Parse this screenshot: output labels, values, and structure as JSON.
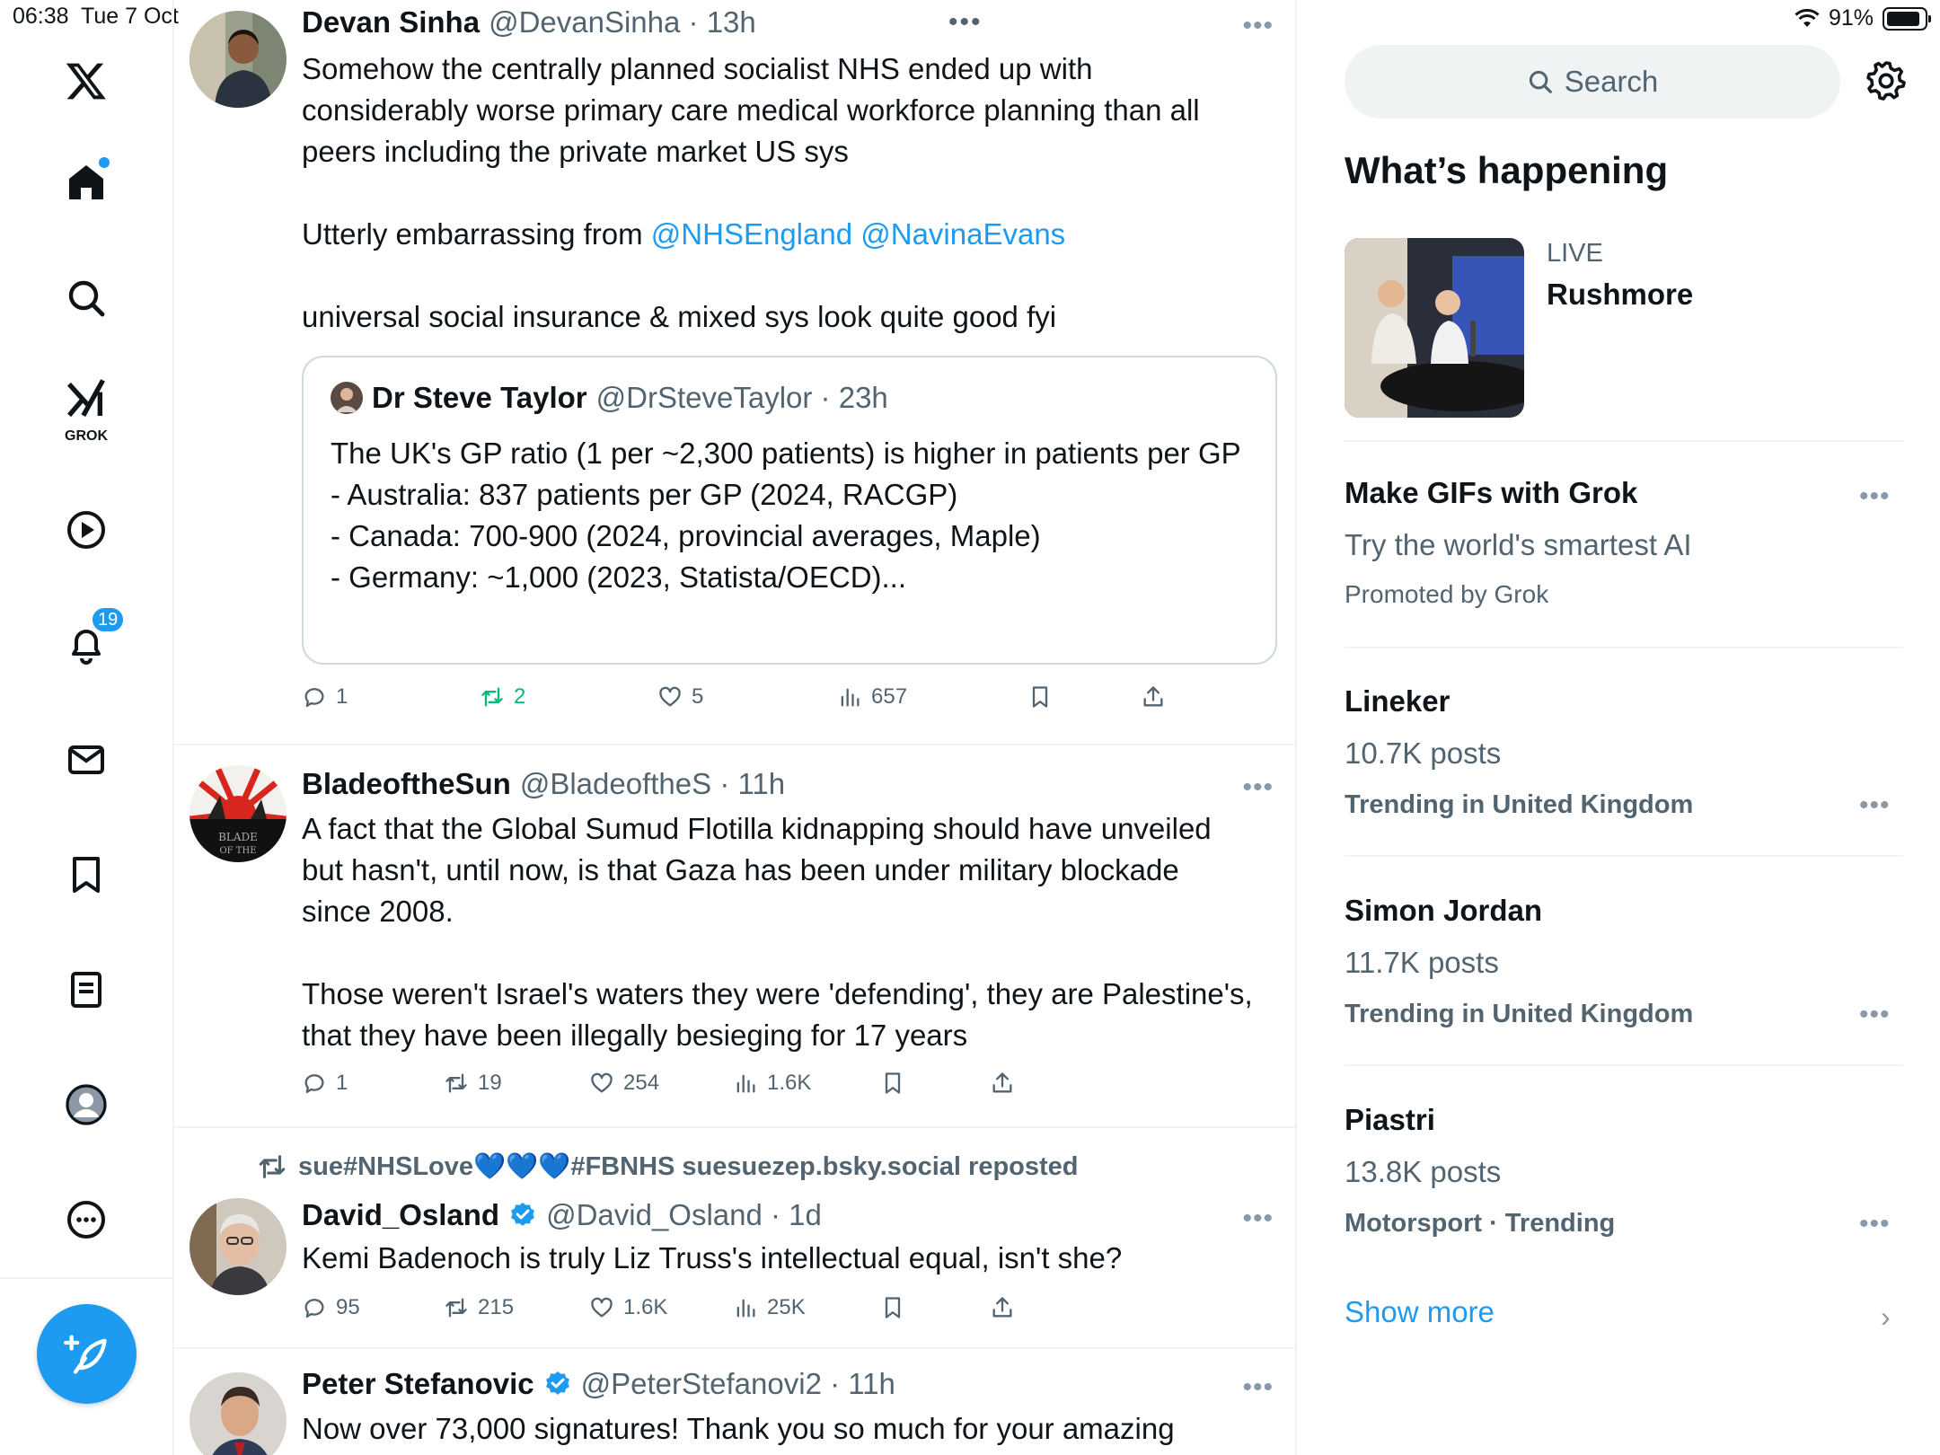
{
  "status_bar": {
    "time": "06:38",
    "date": "Tue 7 Oct",
    "battery": "91%",
    "battery_level": 0.91
  },
  "nav": {
    "grok_label": "GROK",
    "notifications_badge": "19",
    "items": [
      "x-logo-icon",
      "home-icon",
      "search-icon",
      "grok-icon",
      "video-icon",
      "notifications-icon",
      "messages-icon",
      "bookmarks-icon",
      "lists-icon",
      "profile-icon",
      "more-icon"
    ]
  },
  "colors": {
    "accent": "#1d9bf0",
    "repost_green": "#00ba7c",
    "secondary_text": "#536471"
  },
  "posts": [
    {
      "name": "Devan Sinha",
      "meta": "@DevanSinha · 13h",
      "body": [
        "Somehow the centrally planned socialist NHS ended up with considerably worse primary care medical workforce planning than all peers including the private market US sys",
        "Utterly embarrassing from",
        "universal social insurance & mixed sys look quite good fyi"
      ],
      "mentions": [
        "@NHSEngland",
        "@NavinaEvans"
      ],
      "quote": {
        "name": "Dr Steve Taylor",
        "meta": "@DrSteveTaylor · 23h",
        "lines": [
          "The UK's GP ratio (1 per ~2,300 patients) is higher in patients per GP",
          "- Australia: 837 patients per GP (2024, RACGP)",
          "- Canada: 700-900 (2024, provincial averages, Maple)",
          "- Germany: ~1,000 (2023, Statista/OECD)..."
        ]
      },
      "stats": {
        "replies": "1",
        "reposts": "2",
        "likes": "5",
        "views": "657"
      }
    },
    {
      "name": "BladeoftheSun",
      "meta": "@BladeoftheS · 11h",
      "body": [
        "A fact that the Global Sumud Flotilla kidnapping should have unveiled but hasn't, until now, is that Gaza has been under military blockade since 2008.",
        "Those weren't Israel's waters they were 'defending', they are Palestine's, that they have been illegally besieging for 17 years"
      ],
      "stats": {
        "replies": "1",
        "reposts": "19",
        "likes": "254",
        "views": "1.6K"
      }
    },
    {
      "reposted_by": "sue#NHSLove💙💙💙#FBNHS suesuezep.bsky.social reposted",
      "name": "David_Osland",
      "meta": "@David_Osland · 1d",
      "body": [
        "Kemi Badenoch is truly Liz Truss's intellectual equal, isn't she?"
      ],
      "stats": {
        "replies": "95",
        "reposts": "215",
        "likes": "1.6K",
        "views": "25K"
      }
    },
    {
      "name": "Peter Stefanovic",
      "meta": "@PeterStefanovi2 · 11h",
      "body": [
        "Now over 73,000 signatures! Thank you so much for your amazing"
      ]
    }
  ],
  "sidebar": {
    "search_placeholder": "Search",
    "title": "What’s happening",
    "live": {
      "label": "LIVE",
      "title": "Rushmore"
    },
    "promo": {
      "title": "Make GIFs with Grok",
      "subtitle": "Try the world's smartest AI",
      "promoted": "Promoted by Grok"
    },
    "trends": [
      {
        "name": "Lineker",
        "posts": "10.7K posts",
        "context": "Trending in United Kingdom"
      },
      {
        "name": "Simon Jordan",
        "posts": "11.7K posts",
        "context": "Trending in United Kingdom"
      },
      {
        "name": "Piastri",
        "posts": "13.8K posts",
        "context": "Motorsport · Trending"
      }
    ],
    "show_more": "Show more"
  }
}
